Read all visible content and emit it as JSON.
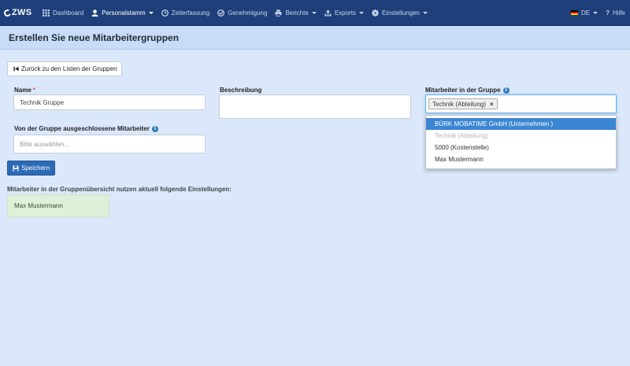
{
  "nav": {
    "brand": "ZWS",
    "items": [
      {
        "label": "Dashboard",
        "icon": "grid-icon"
      },
      {
        "label": "Personalstamm",
        "icon": "user-icon",
        "active": true,
        "dropdown": true
      },
      {
        "label": "Zeiterfassung",
        "icon": "clock-icon"
      },
      {
        "label": "Genehmigung",
        "icon": "check-circle-icon"
      },
      {
        "label": "Berichte",
        "icon": "print-icon",
        "dropdown": true
      },
      {
        "label": "Exports",
        "icon": "export-icon",
        "dropdown": true
      },
      {
        "label": "Einstellungen",
        "icon": "gear-icon",
        "dropdown": true
      }
    ],
    "language": "DE",
    "help": "Hilfe"
  },
  "page": {
    "title": "Erstellen Sie neue Mitarbeitergruppen",
    "back_button": "Zurück zu den Listen der Gruppen"
  },
  "form": {
    "name_label": "Name",
    "name_required": "*",
    "name_value": "Technik Gruppe",
    "description_label": "Beschreibung",
    "description_value": "",
    "members_label": "Mitarbeiter in der Gruppe",
    "selected_tag": "Technik (Abteilung)",
    "tag_remove": "×",
    "excluded_label": "Von der Gruppe ausgeschlossene Mitarbeiter",
    "excluded_placeholder": "Bitte auswählen...",
    "save_button": "Speichern"
  },
  "dropdown": {
    "options": [
      {
        "label": "BÜRK MOBATIME GmbH (Unternehmen )",
        "state": "highlighted"
      },
      {
        "label": "Technik (Abteilung)",
        "state": "disabled"
      },
      {
        "label": "5000 (Kostenstelle)",
        "state": "normal"
      },
      {
        "label": "Max Mustermann",
        "state": "normal"
      }
    ]
  },
  "summary": {
    "text": "Mitarbeiter in der Gruppenübersicht nutzen aktuell folgende Einstellungen:",
    "members": [
      "Max Mustermann"
    ]
  },
  "colors": {
    "navbar": "#1e3f7a",
    "header": "#c8dcf7",
    "background": "#dbe8fb",
    "primary": "#2d6ab6",
    "highlight": "#3b86d2",
    "success_bg": "#dff0d8"
  }
}
